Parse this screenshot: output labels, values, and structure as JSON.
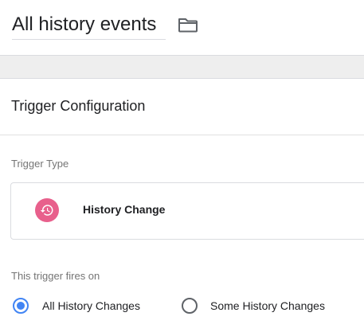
{
  "header": {
    "trigger_name": "All history events",
    "folder_icon": "folder-icon"
  },
  "card": {
    "title": "Trigger Configuration",
    "trigger_type_label": "Trigger Type",
    "trigger_type": {
      "name": "History Change",
      "icon": "history-icon",
      "icon_color": "#e8608c"
    },
    "fires_on_label": "This trigger fires on",
    "fires_on_options": [
      {
        "label": "All History Changes",
        "selected": true
      },
      {
        "label": "Some History Changes",
        "selected": false
      }
    ]
  },
  "colors": {
    "accent": "#4285f4",
    "secondary_text": "#757575",
    "divider": "#dadce0",
    "band": "#eeeeee"
  }
}
